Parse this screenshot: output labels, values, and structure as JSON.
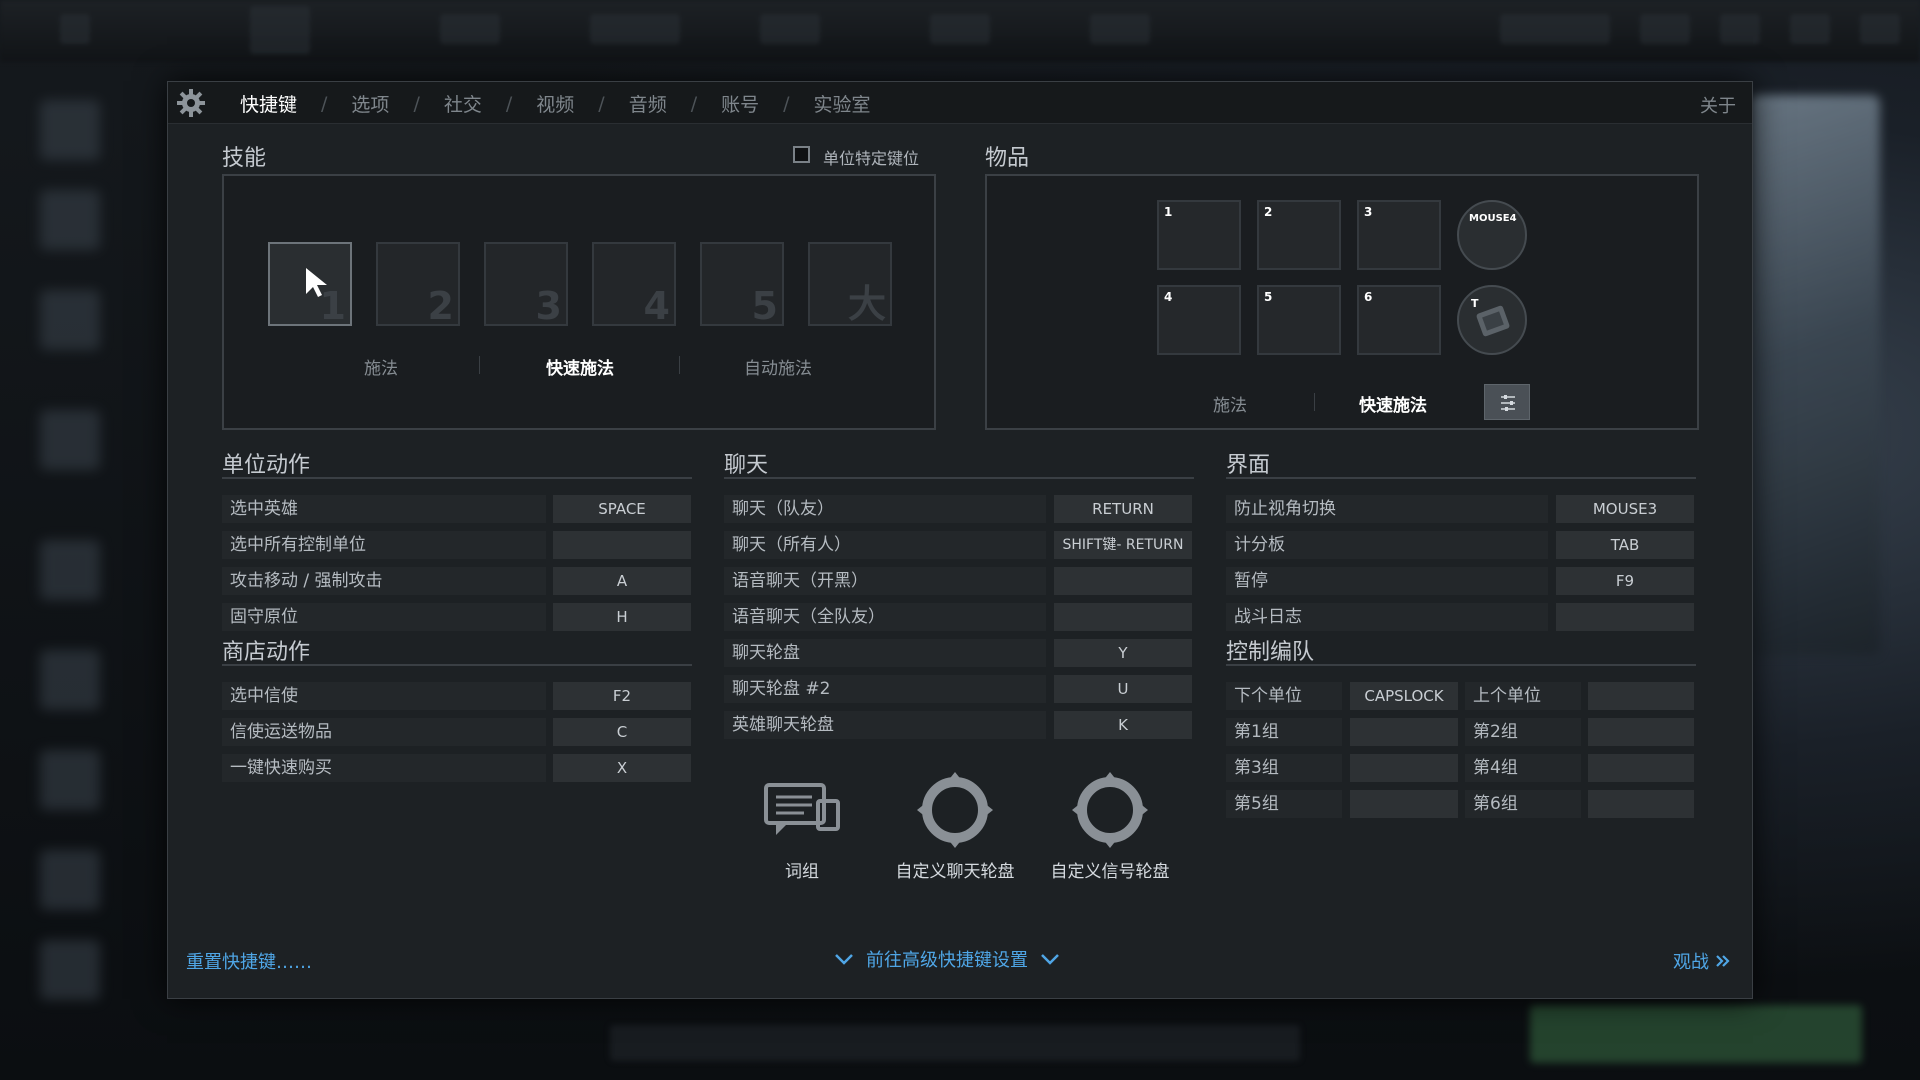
{
  "tabs": [
    "快捷键",
    "选项",
    "社交",
    "视频",
    "音频",
    "账号",
    "实验室"
  ],
  "about": "关于",
  "abilities": {
    "title": "技能",
    "unit_specific_label": "单位特定键位",
    "slots": [
      "1",
      "2",
      "3",
      "4",
      "5",
      "大"
    ],
    "cast_modes": [
      "施法",
      "快速施法",
      "自动施法"
    ]
  },
  "items": {
    "title": "物品",
    "slots": [
      "1",
      "2",
      "3",
      "4",
      "5",
      "6"
    ],
    "round_keys": [
      "MOUSE4",
      "T"
    ],
    "cast_modes": [
      "施法",
      "快速施法"
    ]
  },
  "unit_actions": {
    "title": "单位动作",
    "rows": [
      {
        "label": "选中英雄",
        "key": "SPACE"
      },
      {
        "label": "选中所有控制单位",
        "key": ""
      },
      {
        "label": "攻击移动 / 强制攻击",
        "key": "A"
      },
      {
        "label": "固守原位",
        "key": "H"
      }
    ]
  },
  "shop_actions": {
    "title": "商店动作",
    "rows": [
      {
        "label": "选中信使",
        "key": "F2"
      },
      {
        "label": "信使运送物品",
        "key": "C"
      },
      {
        "label": "一键快速购买",
        "key": "X"
      }
    ]
  },
  "chat": {
    "title": "聊天",
    "rows": [
      {
        "label": "聊天（队友）",
        "key": "RETURN"
      },
      {
        "label": "聊天（所有人）",
        "key": "SHIFT键- RETURN"
      },
      {
        "label": "语音聊天（开黑）",
        "key": ""
      },
      {
        "label": "语音聊天（全队友）",
        "key": ""
      },
      {
        "label": "聊天轮盘",
        "key": "Y"
      },
      {
        "label": "聊天轮盘 #2",
        "key": "U"
      },
      {
        "label": "英雄聊天轮盘",
        "key": "K"
      }
    ],
    "icons": [
      "词组",
      "自定义聊天轮盘",
      "自定义信号轮盘"
    ]
  },
  "interface": {
    "title": "界面",
    "rows": [
      {
        "label": "防止视角切换",
        "key": "MOUSE3"
      },
      {
        "label": "计分板",
        "key": "TAB"
      },
      {
        "label": "暂停",
        "key": "F9"
      },
      {
        "label": "战斗日志",
        "key": ""
      }
    ]
  },
  "control_groups": {
    "title": "控制编队",
    "rows": [
      {
        "l1": "下个单位",
        "k1": "CAPSLOCK",
        "l2": "上个单位",
        "k2": ""
      },
      {
        "l1": "第1组",
        "k1": "",
        "l2": "第2组",
        "k2": ""
      },
      {
        "l1": "第3组",
        "k1": "",
        "l2": "第4组",
        "k2": ""
      },
      {
        "l1": "第5组",
        "k1": "",
        "l2": "第6组",
        "k2": ""
      }
    ]
  },
  "footer": {
    "reset": "重置快捷键……",
    "advanced": "前往高级快捷键设置",
    "spectate": "观战"
  },
  "colors": {
    "accent": "#4fa6e6",
    "panel": "#1d2124"
  }
}
